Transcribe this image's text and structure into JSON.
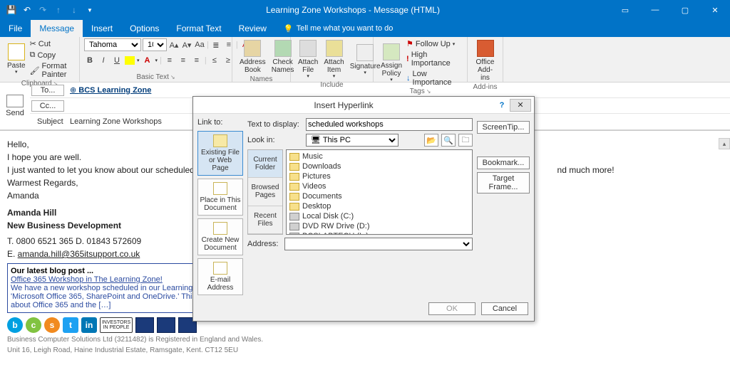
{
  "window": {
    "title": "Learning Zone Workshops - Message (HTML)"
  },
  "menu": {
    "file": "File",
    "tabs": [
      "Message",
      "Insert",
      "Options",
      "Format Text",
      "Review"
    ],
    "active": "Message",
    "tellme": "Tell me what you want to do"
  },
  "ribbon": {
    "clipboard": {
      "paste": "Paste",
      "cut": "Cut",
      "copy": "Copy",
      "painter": "Format Painter",
      "label": "Clipboard"
    },
    "font": {
      "name": "Tahoma",
      "size": "10",
      "label": "Basic Text"
    },
    "names": {
      "address": "Address\nBook",
      "check": "Check\nNames",
      "label": "Names"
    },
    "include": {
      "attachfile": "Attach\nFile",
      "attachitem": "Attach\nItem",
      "signature": "Signature",
      "label": "Include"
    },
    "tags": {
      "assign": "Assign\nPolicy",
      "followup": "Follow Up",
      "high": "High Importance",
      "low": "Low Importance",
      "label": "Tags"
    },
    "addins": {
      "office": "Office\nAdd-ins",
      "label": "Add-ins"
    }
  },
  "compose": {
    "send": "Send",
    "to_label": "To...",
    "to_value": "BCS Learning Zone",
    "cc_label": "Cc...",
    "cc_value": "",
    "subject_label": "Subject",
    "subject_value": "Learning Zone Workshops"
  },
  "body": {
    "l1": "Hello,",
    "l2": "I hope you are well.",
    "l3_a": "I just wanted to let you know about our scheduled works",
    "l3_b": "nd much more!",
    "l4": "Warmest Regards,",
    "l5": "Amanda",
    "sig_name": "Amanda Hill",
    "sig_role": "New Business Development",
    "phone": "T. 0800 6521 365  D. 01843 572609",
    "email_prefix": "E. ",
    "email": "amanda.hill@365itsupport.co.uk",
    "blog_title": "Our latest blog post ...",
    "blog_link": "Office 365 Workshop in The Learning Zone!",
    "blog_text": "We have a new workshop scheduled in our Learning Zone called 'Microsoft Office 365, SharePoint and OneDrive.' This session is all about Office 365 and the […]",
    "footer1": "Business Computer Solutions Ltd (3211482) is Registered in England and Wales.",
    "footer2": "Unit 16, Leigh Road, Haine Industrial Estate, Ramsgate, Kent. CT12 5EU"
  },
  "dialog": {
    "title": "Insert Hyperlink",
    "linkto_label": "Link to:",
    "opts": {
      "existing": "Existing File or Web Page",
      "placein": "Place in This Document",
      "newdoc": "Create New Document",
      "email": "E-mail Address"
    },
    "text_to_display_label": "Text to display:",
    "text_to_display": "scheduled workshops",
    "lookin_label": "Look in:",
    "lookin_value": "This PC",
    "tabs": {
      "current": "Current Folder",
      "browsed": "Browsed Pages",
      "recent": "Recent Files"
    },
    "files": [
      "Music",
      "Downloads",
      "Pictures",
      "Videos",
      "Documents",
      "Desktop",
      "Local Disk (C:)",
      "DVD RW Drive (D:)",
      "BCSLABTECH (L:)"
    ],
    "file_types": [
      "folder",
      "folder",
      "folder",
      "folder",
      "folder",
      "folder",
      "drive",
      "drive",
      "drive"
    ],
    "address_label": "Address:",
    "address_value": "",
    "btn_screentip": "ScreenTip...",
    "btn_bookmark": "Bookmark...",
    "btn_target": "Target Frame...",
    "btn_ok": "OK",
    "btn_cancel": "Cancel"
  }
}
